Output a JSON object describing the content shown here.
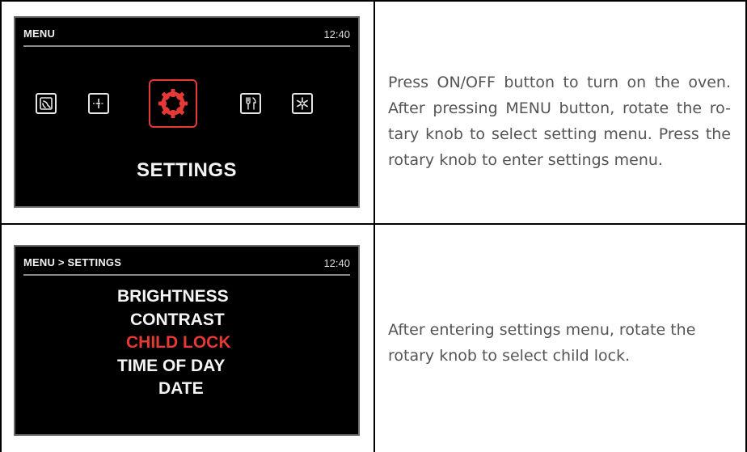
{
  "rows": [
    {
      "screen": {
        "breadcrumb": "MENU",
        "time": "12:40",
        "icons": [
          "picture-icon",
          "graph-icon",
          "gear-icon",
          "tools-icon",
          "snowflake-icon"
        ],
        "selected_icon": "gear-icon",
        "label": "SETTINGS"
      },
      "description": "Press ON/OFF button to turn on the oven. After pressing MENU button, rotate the ro- tary knob to select setting menu. Press the rotary knob to enter settings menu."
    },
    {
      "screen": {
        "breadcrumb": "MENU > SETTINGS",
        "time": "12:40",
        "items": [
          "BRIGHTNESS",
          "CONTRAST",
          "CHILD LOCK",
          "TIME OF DAY",
          "DATE"
        ],
        "selected_item": "CHILD LOCK"
      },
      "description": "After entering settings menu, rotate the rotary knob to select child lock."
    }
  ],
  "colors": {
    "selected": "#e53935",
    "screen_background": "#000000",
    "description_text": "#555555"
  }
}
